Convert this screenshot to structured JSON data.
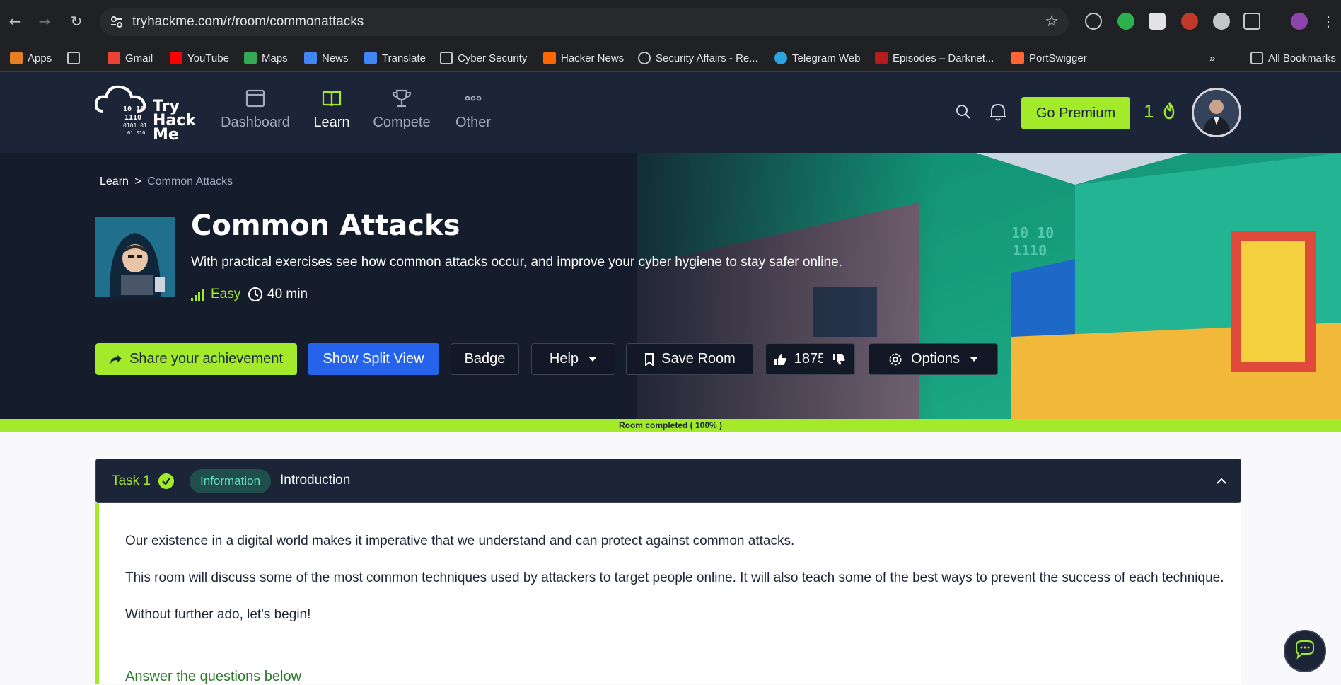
{
  "browser": {
    "url": "tryhackme.com/r/room/commonattacks",
    "bookmarks": [
      {
        "label": "Apps",
        "icon": "apps-grid-icon"
      },
      {
        "label": "",
        "icon": "grid-icon"
      },
      {
        "label": "Gmail",
        "icon": "gmail-icon"
      },
      {
        "label": "YouTube",
        "icon": "youtube-icon"
      },
      {
        "label": "Maps",
        "icon": "maps-icon"
      },
      {
        "label": "News",
        "icon": "news-icon"
      },
      {
        "label": "Translate",
        "icon": "translate-icon"
      },
      {
        "label": "Cyber Security",
        "icon": "folder-icon"
      },
      {
        "label": "Hacker News",
        "icon": "hacker-news-icon"
      },
      {
        "label": "Security Affairs - Re...",
        "icon": "globe-icon"
      },
      {
        "label": "Telegram Web",
        "icon": "telegram-icon"
      },
      {
        "label": "Episodes – Darknet...",
        "icon": "darknet-icon"
      },
      {
        "label": "PortSwigger",
        "icon": "portswigger-icon"
      }
    ],
    "overflow": "»",
    "all_bookmarks": "All Bookmarks"
  },
  "header": {
    "logo_text": [
      "Try",
      "Hack",
      "Me"
    ],
    "nav": [
      {
        "label": "Dashboard",
        "icon": "dashboard-icon",
        "active": false
      },
      {
        "label": "Learn",
        "icon": "book-icon",
        "active": true
      },
      {
        "label": "Compete",
        "icon": "trophy-icon",
        "active": false
      },
      {
        "label": "Other",
        "icon": "more-icon",
        "active": false
      }
    ],
    "go_premium": "Go Premium",
    "streak": "1"
  },
  "room": {
    "breadcrumb_root": "Learn",
    "breadcrumb_sep": ">",
    "breadcrumb_current": "Common Attacks",
    "title": "Common Attacks",
    "description": "With practical exercises see how common attacks occur, and improve your cyber hygiene to stay safer online.",
    "difficulty": "Easy",
    "duration": "40 min",
    "actions": {
      "share": "Share your achievement",
      "split_view": "Show Split View",
      "badge": "Badge",
      "help": "Help",
      "save_room": "Save Room",
      "likes": "1875",
      "options": "Options"
    },
    "progress_text": "Room completed ( 100% )"
  },
  "task": {
    "number": "Task 1",
    "type": "Information",
    "title": "Introduction",
    "paragraphs": [
      "Our existence in a digital world makes it imperative that we understand and can protect against common attacks.",
      "This room will discuss some of the most common techniques used by attackers to target people online. It will also teach some of the best ways to prevent the success of each technique.",
      "Without further ado, let's begin!"
    ],
    "questions_heading": "Answer the questions below"
  },
  "colors": {
    "accent": "#a3ea2a",
    "header_bg": "#1c2538",
    "split_view": "#2563eb"
  }
}
